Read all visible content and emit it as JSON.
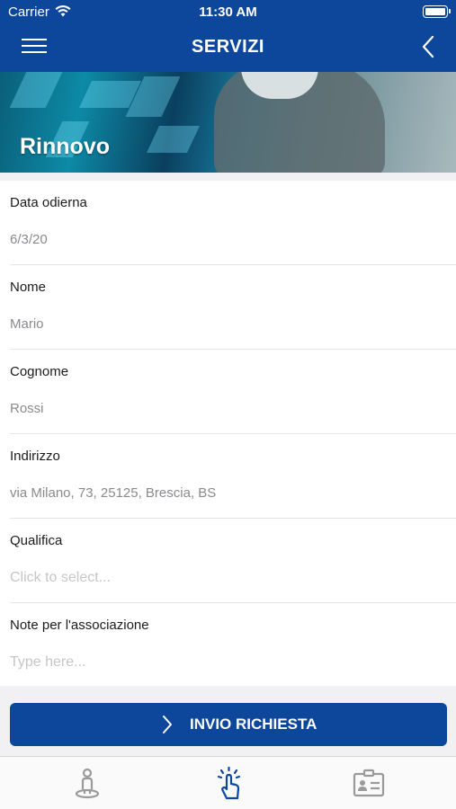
{
  "status_bar": {
    "carrier": "Carrier",
    "time": "11:30 AM"
  },
  "nav": {
    "title": "SERVIZI"
  },
  "banner": {
    "title": "Rinnovo"
  },
  "form": {
    "fields": [
      {
        "label": "Data odierna",
        "value": "6/3/20"
      },
      {
        "label": "Nome",
        "value": "Mario"
      },
      {
        "label": "Cognome",
        "value": "Rossi"
      },
      {
        "label": "Indirizzo",
        "value": "via Milano, 73, 25125, Brescia, BS"
      },
      {
        "label": "Qualifica",
        "placeholder": "Click to select..."
      },
      {
        "label": "Note per l'associazione",
        "placeholder": "Type here..."
      }
    ]
  },
  "submit": {
    "label": "INVIO RICHIESTA"
  },
  "tabbar": {
    "tabs": [
      "location-person-icon",
      "tap-hand-icon",
      "id-card-icon"
    ]
  },
  "colors": {
    "primary": "#0d479c",
    "placeholder": "#c6c6c8",
    "value": "#8a8a8e"
  }
}
